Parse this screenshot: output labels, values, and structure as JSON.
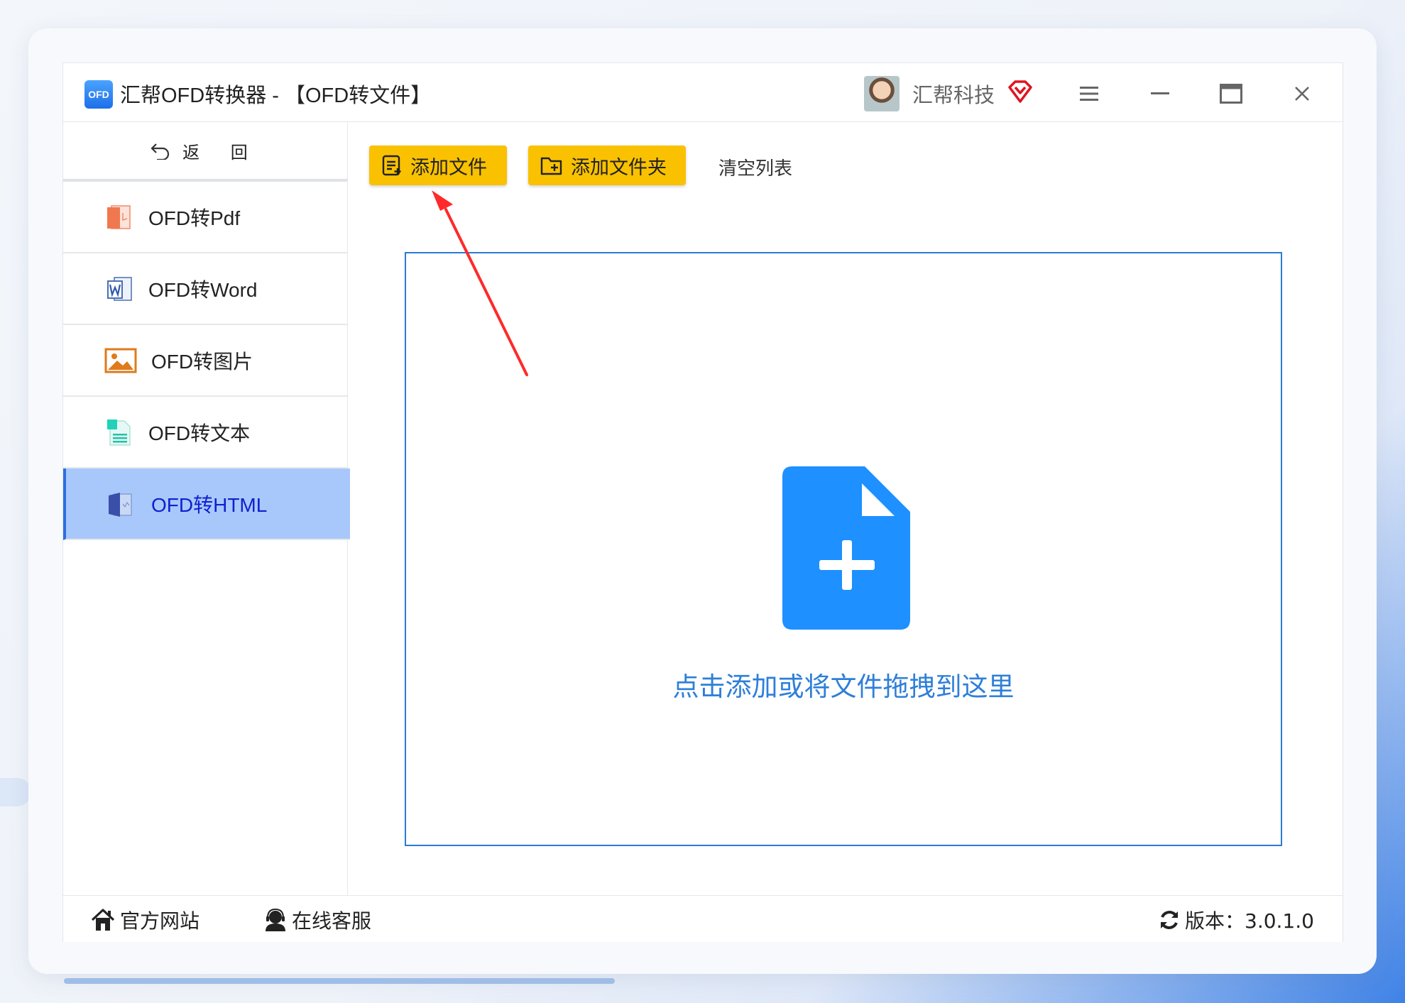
{
  "window": {
    "title": "汇帮OFD转换器 - 【OFD转文件】",
    "logo_text": "OFD",
    "user_name": "汇帮科技"
  },
  "controls": {
    "menu_icon": "hamburger-icon",
    "minimize_icon": "minimize-icon",
    "maximize_icon": "maximize-icon",
    "close_icon": "close-icon"
  },
  "sidebar": {
    "back_label": "返 回",
    "items": [
      {
        "label": "OFD转Pdf",
        "icon": "pdf-icon",
        "active": false
      },
      {
        "label": "OFD转Word",
        "icon": "word-icon",
        "active": false
      },
      {
        "label": "OFD转图片",
        "icon": "image-icon",
        "active": false
      },
      {
        "label": "OFD转文本",
        "icon": "text-file-icon",
        "active": false
      },
      {
        "label": "OFD转HTML",
        "icon": "html-icon",
        "active": true
      }
    ]
  },
  "toolbar": {
    "add_file": "添加文件",
    "add_folder": "添加文件夹",
    "clear_list": "清空列表"
  },
  "dropzone": {
    "hint": "点击添加或将文件拖拽到这里"
  },
  "footer": {
    "website": "官方网站",
    "support": "在线客服",
    "version": "版本：3.0.1.0"
  },
  "colors": {
    "accent_yellow": "#f9c100",
    "accent_blue": "#1e90ff",
    "active_item_bg": "#a8c8fb",
    "annotation_arrow": "#ff2a2a"
  }
}
